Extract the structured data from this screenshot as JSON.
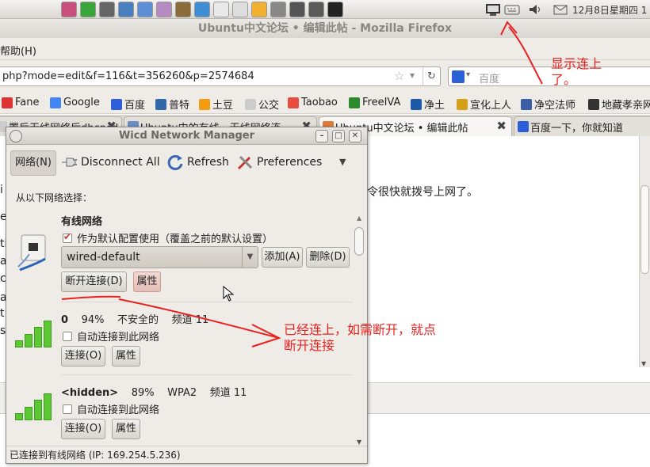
{
  "panel": {
    "clock": "12月8日星期四 1",
    "launchers": [
      "app-icon",
      "google-icon",
      "tool-icon",
      "photo-icon",
      "people-icon",
      "person-icon",
      "books-icon",
      "package-icon",
      "edit-icon",
      "mplayer-icon",
      "headphones-icon",
      "calculator-icon",
      "terminal-icon",
      "monitor-icon",
      "console-icon"
    ]
  },
  "firefox": {
    "title": "Ubuntu中文论坛 • 编辑此帖 - Mozilla Firefox",
    "menu_help": "帮助(H)",
    "url": "php?mode=edit&f=116&t=356260&p=2574684",
    "search_placeholder": "百度",
    "bookmarks": [
      "Fane",
      "Google",
      "百度",
      "普特",
      "土豆",
      "公交",
      "Taobao",
      "FreeIVA",
      "净土",
      "宣化上人",
      "净空法师",
      "地藏孝亲网"
    ],
    "tabs": [
      "置后无线网络后dhcpcd",
      "Ubuntu中的有线、无线网络连",
      "Ubuntu中文论坛 • 编辑此帖",
      "百度一下，你就知道"
    ],
    "content_text": "令很快就拨号上网了。",
    "left_chars": [
      "i",
      "e",
      "ti",
      "a",
      "c",
      "a",
      "t",
      "s"
    ]
  },
  "wicd": {
    "title": "Wicd Network Manager",
    "toolbar": {
      "network": "网络(N)",
      "disconnect_all": "Disconnect All",
      "refresh": "Refresh",
      "preferences": "Preferences"
    },
    "choose_label": "从以下网络选择：",
    "wired": {
      "title": "有线网络",
      "default_check": "作为默认配置使用（覆盖之前的默认设置）",
      "default_checked": true,
      "profile": "wired-default",
      "add": "添加(A)",
      "delete": "删除(D)",
      "disconnect": "断开连接(D)",
      "properties": "属性"
    },
    "wireless": [
      {
        "name": "0",
        "strength": "94%",
        "security": "不安全的",
        "channel": "频道 11",
        "autoconnect": "自动连接到此网络",
        "connect": "连接(O)",
        "properties": "属性",
        "signal_bars": 4
      },
      {
        "name": "<hidden>",
        "strength": "89%",
        "security": "WPA2",
        "channel": "频道 11",
        "autoconnect": "自动连接到此网络",
        "connect": "连接(O)",
        "properties": "属性",
        "signal_bars": 4
      }
    ],
    "status": "已连接到有线网络 (IP: 169.254.5.236)"
  },
  "annotations": {
    "tray_note_line1": "显示连上",
    "tray_note_line2": "了。",
    "disconnect_note_line1": "已经连上，如需断开，就点",
    "disconnect_note_line2": "断开连接"
  },
  "colors": {
    "annotation": "#e8211f",
    "signal": "#5cc833"
  }
}
